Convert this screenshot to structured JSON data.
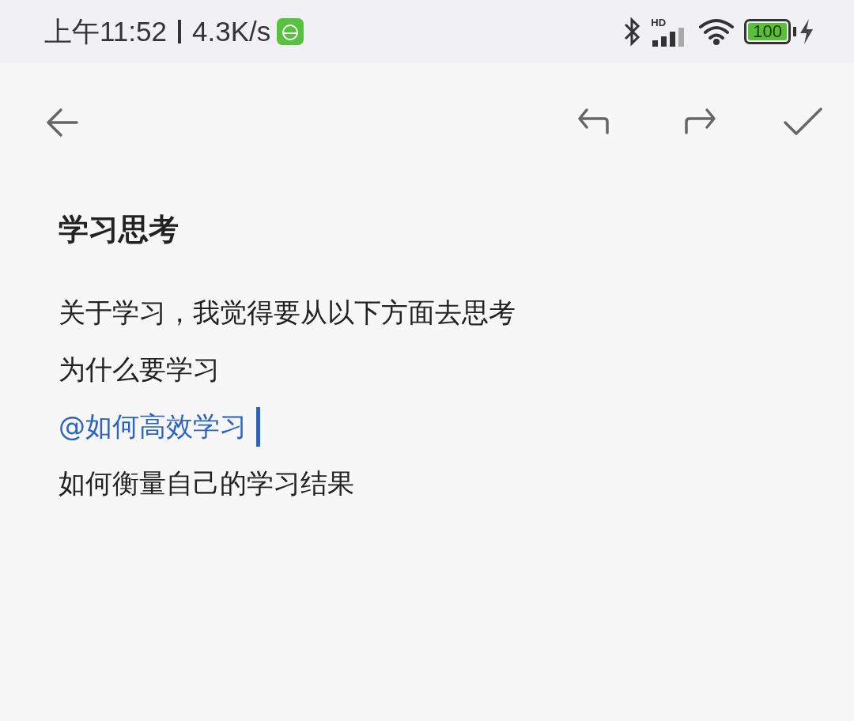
{
  "status_bar": {
    "time": "上午11:52",
    "speed": "4.3K/s",
    "network_label": "HD",
    "battery": "100"
  },
  "note": {
    "title": "学习思考",
    "lines": [
      {
        "kind": "text",
        "text": "关于学习，我觉得要从以下方面去思考",
        "cursor": false
      },
      {
        "kind": "text",
        "text": "为什么要学习",
        "cursor": false
      },
      {
        "kind": "mention",
        "text": "@如何高效学习",
        "cursor": true
      },
      {
        "kind": "text",
        "text": "如何衡量自己的学习结果",
        "cursor": false
      }
    ]
  }
}
